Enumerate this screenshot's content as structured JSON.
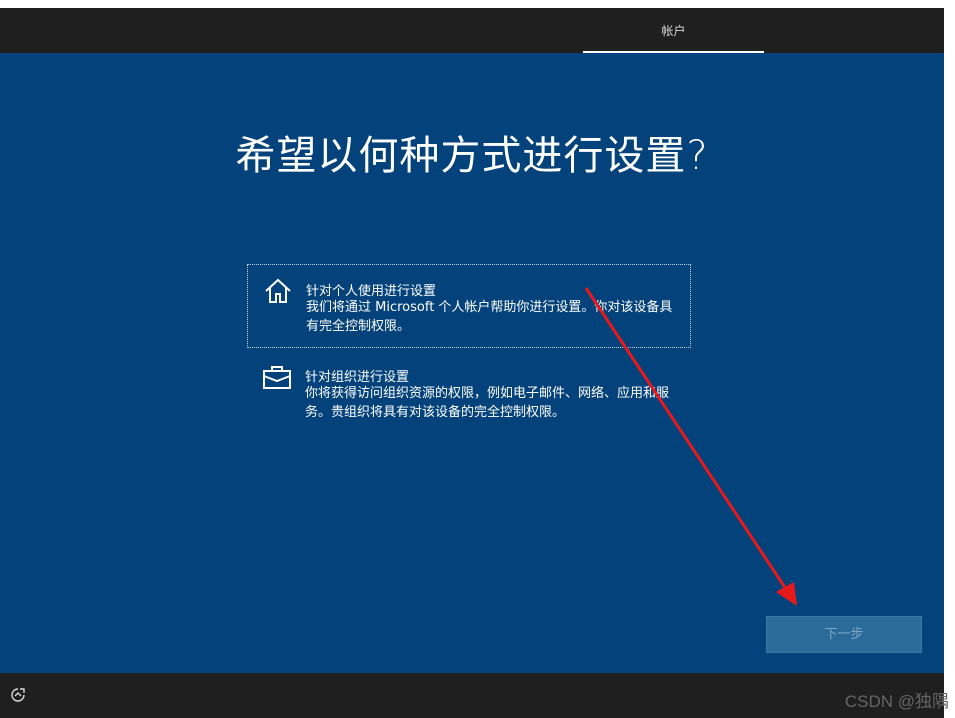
{
  "header": {
    "tab_label": "帐户"
  },
  "main": {
    "title": "希望以何种方式进行设置?",
    "options": [
      {
        "title": "针对个人使用进行设置",
        "description": "我们将通过 Microsoft 个人帐户帮助你进行设置。你对该设备具有完全控制权限。",
        "icon": "home-icon"
      },
      {
        "title": "针对组织进行设置",
        "description": "你将获得访问组织资源的权限，例如电子邮件、网络、应用和服务。贵组织将具有对该设备的完全控制权限。",
        "icon": "briefcase-icon"
      }
    ]
  },
  "footer": {
    "next_label": "下一步",
    "accessibility_icon": "accessibility-icon"
  },
  "watermark": {
    "text": "CSDN @独隅"
  },
  "colors": {
    "background": "#03427a",
    "bars": "#1f1f1f",
    "annotation_arrow": "#e8191a"
  }
}
